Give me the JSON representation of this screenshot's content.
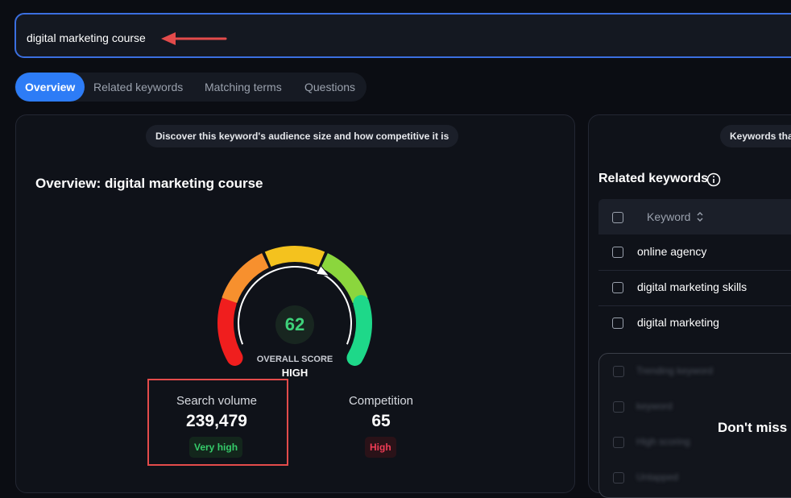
{
  "search": {
    "value": "digital marketing course"
  },
  "tabs": [
    {
      "label": "Overview",
      "active": true
    },
    {
      "label": "Related keywords",
      "active": false
    },
    {
      "label": "Matching terms",
      "active": false
    },
    {
      "label": "Questions",
      "active": false
    }
  ],
  "overview": {
    "info_pill": "Discover this keyword's audience size and how competitive it is",
    "title": "Overview: digital marketing course",
    "score": {
      "value": "62",
      "label": "OVERALL SCORE",
      "rating": "HIGH",
      "fraction": 0.62
    },
    "gauge_colors": [
      "#f01e1e",
      "#f7902e",
      "#f4c21e",
      "#8bd63d",
      "#1ed889"
    ],
    "search_volume": {
      "label": "Search volume",
      "value": "239,479",
      "badge": "Very high"
    },
    "competition": {
      "label": "Competition",
      "value": "65",
      "badge": "High"
    }
  },
  "related": {
    "info_pill": "Keywords tha",
    "title": "Related keywords",
    "column_keyword": "Keyword",
    "rows": [
      "online agency",
      "digital marketing skills",
      "digital marketing"
    ],
    "locked_rows": [
      "Trending keyword",
      "keyword",
      "High scoring",
      "Untapped"
    ],
    "locked_heading": "Don't miss"
  },
  "colors": {
    "accent": "#2d7cf6",
    "arrow": "#e34b4b"
  }
}
